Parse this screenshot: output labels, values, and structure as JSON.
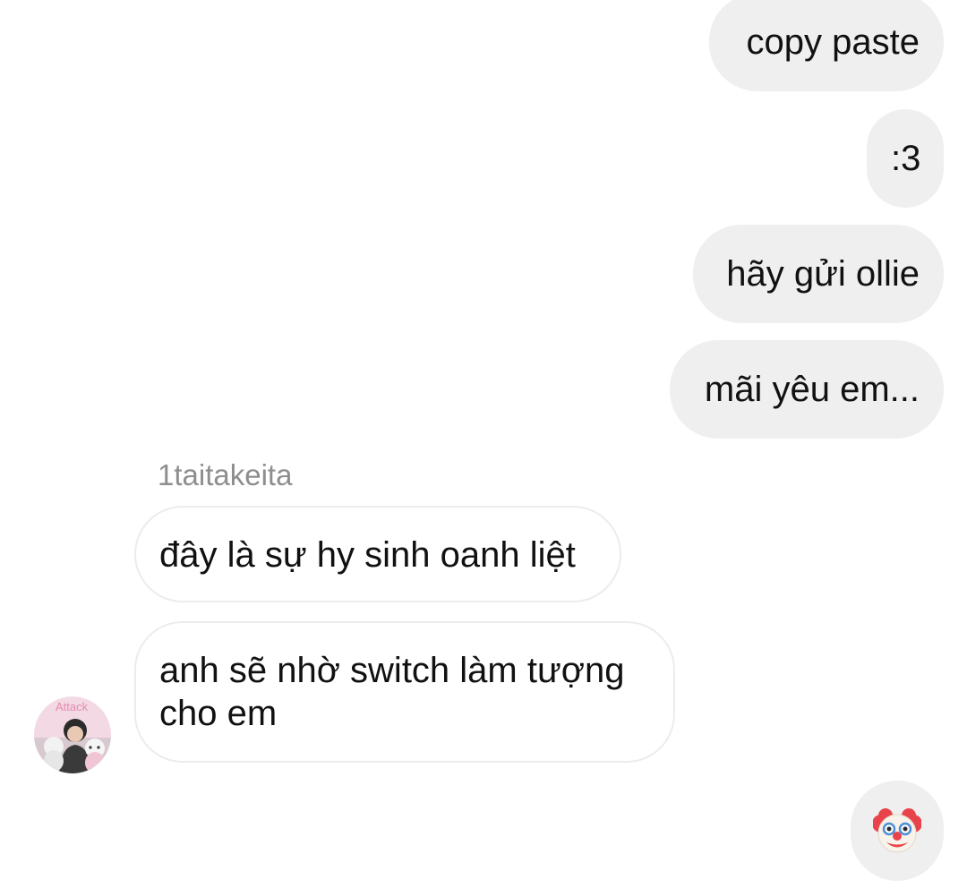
{
  "outgoing_messages": [
    {
      "text": "copy paste"
    },
    {
      "text": ":3"
    },
    {
      "text": "hãy gửi ollie"
    },
    {
      "text": "mãi yêu em..."
    }
  ],
  "incoming_sender": "1taitakeita",
  "incoming_messages": [
    {
      "text": "đây là sự hy sinh oanh liệt"
    },
    {
      "text": "anh sẽ nhờ switch làm tượng\ncho em"
    }
  ],
  "avatar": {
    "icon": "profile-avatar",
    "watermark_text": "Attack"
  },
  "emoji_reply": {
    "icon": "clown-face-emoji"
  },
  "colors": {
    "outgoing_bubble": "#efefef",
    "incoming_border": "#ececec",
    "sender_name": "#8e8e8e",
    "text": "#111111"
  }
}
